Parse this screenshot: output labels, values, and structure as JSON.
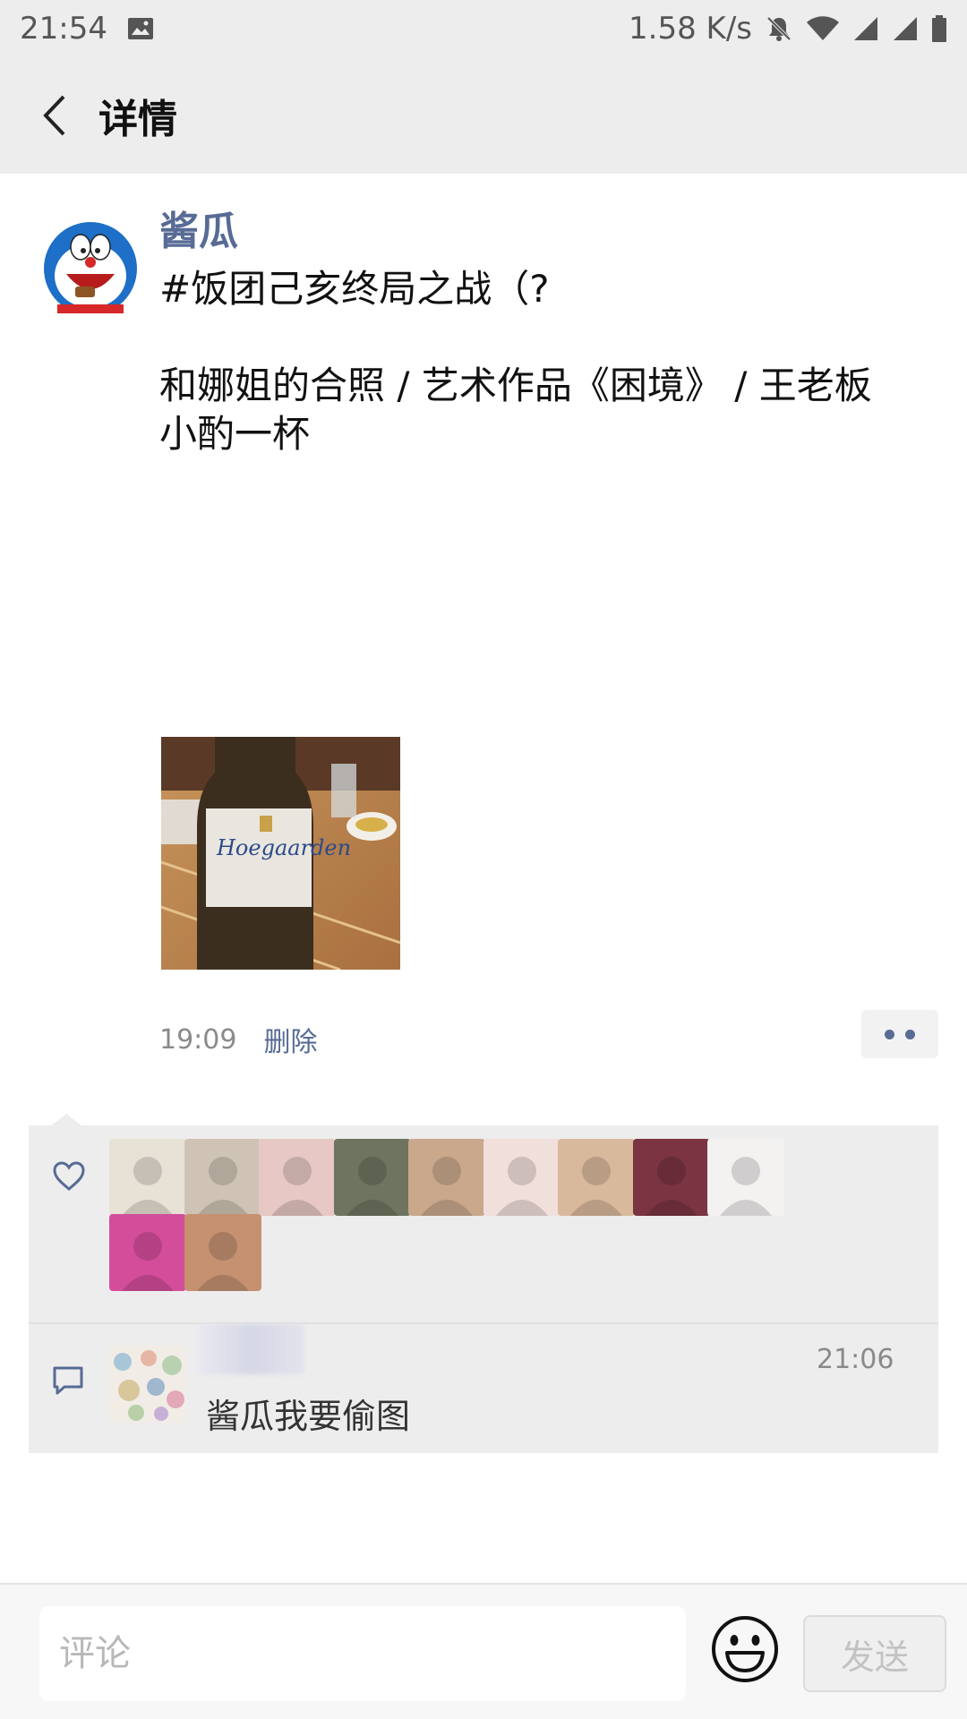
{
  "status_bar": {
    "time": "21:54",
    "net_speed": "1.58 K/s"
  },
  "header": {
    "title": "详情"
  },
  "post": {
    "author": "酱瓜",
    "text": "#饭团己亥终局之战（?\n\n和娜姐的合照 / 艺术作品《困境》 / 王老板\n小酌一杯",
    "photo_label": "Hoegaarden",
    "time": "19:09",
    "delete_label": "删除"
  },
  "likes": {
    "count": 11,
    "avatar_colors": [
      "#e8e1d6",
      "#cfc3b6",
      "#e7c8c4",
      "#6f7460",
      "#c9a88c",
      "#f1dfdc",
      "#d9b99c",
      "#7a3442",
      "#f4f1f1",
      "#d44d9b",
      "#c59170"
    ]
  },
  "comments": [
    {
      "text": "酱瓜我要偷图",
      "time": "21:06"
    }
  ],
  "composer": {
    "placeholder": "评论",
    "send_label": "发送"
  },
  "colors": {
    "link": "#576b95",
    "panel": "#ededed"
  }
}
